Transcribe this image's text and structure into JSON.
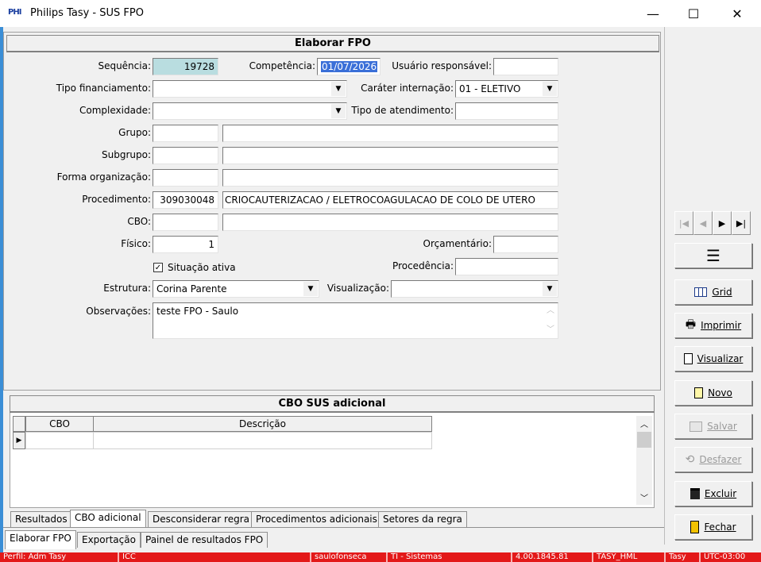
{
  "window": {
    "app_icon_text": "PHI",
    "title": "Philips Tasy - SUS FPO",
    "minimize": "—",
    "maximize": "☐",
    "close": "✕"
  },
  "form": {
    "header": "Elaborar FPO",
    "sequencia": {
      "label": "Sequência:",
      "value": "19728"
    },
    "competencia": {
      "label": "Competência:",
      "value": "01/07/2026"
    },
    "usuario": {
      "label": "Usuário responsável:",
      "value": ""
    },
    "tipo_financiamento": {
      "label": "Tipo financiamento:",
      "value": ""
    },
    "carater_internacao": {
      "label": "Caráter internação:",
      "value": "01 - ELETIVO"
    },
    "complexidade": {
      "label": "Complexidade:",
      "value": ""
    },
    "tipo_atendimento": {
      "label": "Tipo de atendimento:",
      "value": ""
    },
    "grupo": {
      "label": "Grupo:",
      "code": "",
      "desc": ""
    },
    "subgrupo": {
      "label": "Subgrupo:",
      "code": "",
      "desc": ""
    },
    "forma_organizacao": {
      "label": "Forma organização:",
      "code": "",
      "desc": ""
    },
    "procedimento": {
      "label": "Procedimento:",
      "code": "309030048",
      "desc": "CRIOCAUTERIZACAO / ELETROCOAGULACAO DE COLO DE UTERO"
    },
    "cbo": {
      "label": "CBO:",
      "code": "",
      "desc": ""
    },
    "fisico": {
      "label": "Físico:",
      "value": "1"
    },
    "orcamentario": {
      "label": "Orçamentário:",
      "value": ""
    },
    "situacao_ativa": {
      "label": "Situação ativa",
      "checked": true,
      "mark": "✓"
    },
    "procedencia": {
      "label": "Procedência:",
      "value": ""
    },
    "estrutura": {
      "label": "Estrutura:",
      "value": "Corina Parente"
    },
    "visualizacao": {
      "label": "Visualização:",
      "value": ""
    },
    "observacoes": {
      "label": "Observações:",
      "value": "teste FPO - Saulo"
    }
  },
  "cbo_sus": {
    "header": "CBO SUS adicional",
    "columns": [
      "CBO",
      "Descrição"
    ],
    "row_indicator": "▶"
  },
  "inner_tabs": [
    "Resultados",
    "CBO adicional",
    "Desconsiderar regra",
    "Procedimentos adicionais",
    "Setores da regra"
  ],
  "inner_tab_active": "CBO adicional",
  "outer_tabs": [
    "Elaborar FPO",
    "Exportação",
    "Painel de resultados FPO"
  ],
  "outer_tab_active": "Elaborar FPO",
  "toolbar": {
    "nav": [
      "|◀",
      "◀",
      "▶",
      "▶|"
    ],
    "menu_icon": "☰",
    "buttons": [
      {
        "label": "Grid",
        "icon": "grid-icon",
        "enabled": true
      },
      {
        "label": "Imprimir",
        "icon": "printer-icon",
        "enabled": true
      },
      {
        "label": "Visualizar",
        "icon": "document-icon",
        "enabled": true
      },
      {
        "label": "Novo",
        "icon": "new-document-icon",
        "enabled": true
      },
      {
        "label": "Salvar",
        "icon": "save-icon",
        "enabled": false
      },
      {
        "label": "Desfazer",
        "icon": "undo-icon",
        "enabled": false
      },
      {
        "label": "Excluir",
        "icon": "trash-icon",
        "enabled": true
      },
      {
        "label": "Fechar",
        "icon": "exit-door-icon",
        "enabled": true
      }
    ]
  },
  "statusbar": {
    "perfil": "Perfil: Adm Tasy",
    "icc": "ICC",
    "user": "saulofonseca",
    "dept": "TI - Sistemas",
    "version": "4.00.1845.81",
    "server": "TASY_HML",
    "app": "Tasy",
    "tz": "UTC-03:00"
  },
  "colors": {
    "readonly_bg": "#b9dde0",
    "selection": "#3a6fd8",
    "statusbar": "#e31919",
    "frame": "#3b8ed6"
  }
}
